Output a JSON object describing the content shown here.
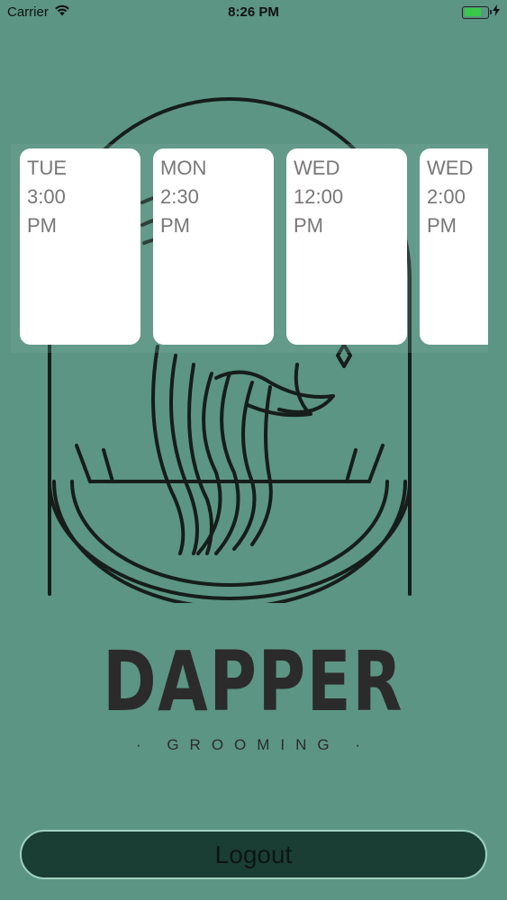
{
  "status_bar": {
    "carrier": "Carrier",
    "time": "8:26 PM",
    "battery_level": 0.75,
    "battery_color": "#38c94a"
  },
  "cards": [
    {
      "day": "TUE",
      "time": "3:00",
      "ampm": "PM"
    },
    {
      "day": "MON",
      "time": "2:30",
      "ampm": "PM"
    },
    {
      "day": "WED",
      "time": "12:00",
      "ampm": "PM"
    },
    {
      "day": "WED",
      "time": "2:00",
      "ampm": "PM"
    }
  ],
  "brand": {
    "name": "DAPPER",
    "subtitle": "· GROOMING ·"
  },
  "logout_label": "Logout",
  "colors": {
    "background": "#5c9583",
    "button": "#1b3e34",
    "button_border": "#9ed1c0"
  }
}
